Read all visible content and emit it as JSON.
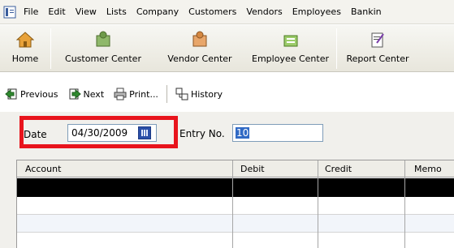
{
  "menubar": {
    "items": [
      "File",
      "Edit",
      "View",
      "Lists",
      "Company",
      "Customers",
      "Vendors",
      "Employees",
      "Bankin"
    ]
  },
  "iconbar": {
    "home": "Home",
    "customer_center": "Customer Center",
    "vendor_center": "Vendor Center",
    "employee_center": "Employee Center",
    "report_center": "Report Center"
  },
  "actions": {
    "previous": "Previous",
    "next": "Next",
    "print": "Print...",
    "history": "History"
  },
  "form": {
    "date_label": "Date",
    "date_value": "04/30/2009",
    "entry_label": "Entry No.",
    "entry_value": "10"
  },
  "table": {
    "columns": [
      "Account",
      "Debit",
      "Credit",
      "Memo"
    ]
  },
  "colors": {
    "highlight": "#e8141c",
    "selection": "#316ac5"
  }
}
